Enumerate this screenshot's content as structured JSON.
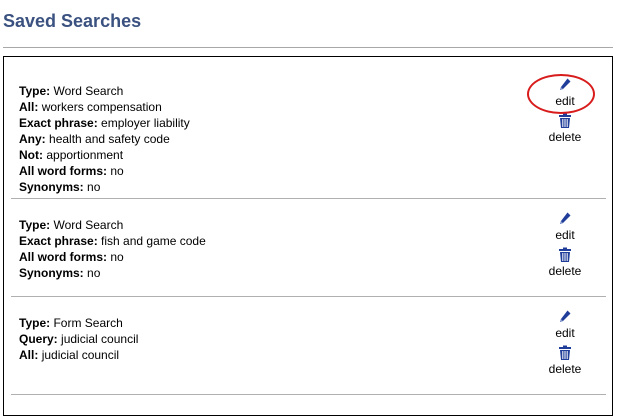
{
  "page": {
    "title": "Saved Searches"
  },
  "actions": {
    "edit_label": "edit",
    "delete_label": "delete",
    "edit_icon": "pencil-icon",
    "delete_icon": "trash-icon"
  },
  "colors": {
    "title": "#3b5280",
    "icon": "#1f3d99",
    "highlight": "#d81c1c"
  },
  "searches": [
    {
      "fields": [
        {
          "label": "Type:",
          "value": "Word Search"
        },
        {
          "label": "All:",
          "value": "workers compensation"
        },
        {
          "label": "Exact phrase:",
          "value": "employer liability"
        },
        {
          "label": "Any:",
          "value": "health and safety code"
        },
        {
          "label": "Not:",
          "value": "apportionment"
        },
        {
          "label": "All word forms:",
          "value": "no"
        },
        {
          "label": "Synonyms:",
          "value": "no"
        }
      ]
    },
    {
      "fields": [
        {
          "label": "Type:",
          "value": "Word Search"
        },
        {
          "label": "Exact phrase:",
          "value": "fish and game code"
        },
        {
          "label": "All word forms:",
          "value": "no"
        },
        {
          "label": "Synonyms:",
          "value": "no"
        }
      ]
    },
    {
      "fields": [
        {
          "label": "Type:",
          "value": "Form Search"
        },
        {
          "label": "Query:",
          "value": "judicial council"
        },
        {
          "label": "All:",
          "value": "judicial council"
        }
      ]
    }
  ]
}
